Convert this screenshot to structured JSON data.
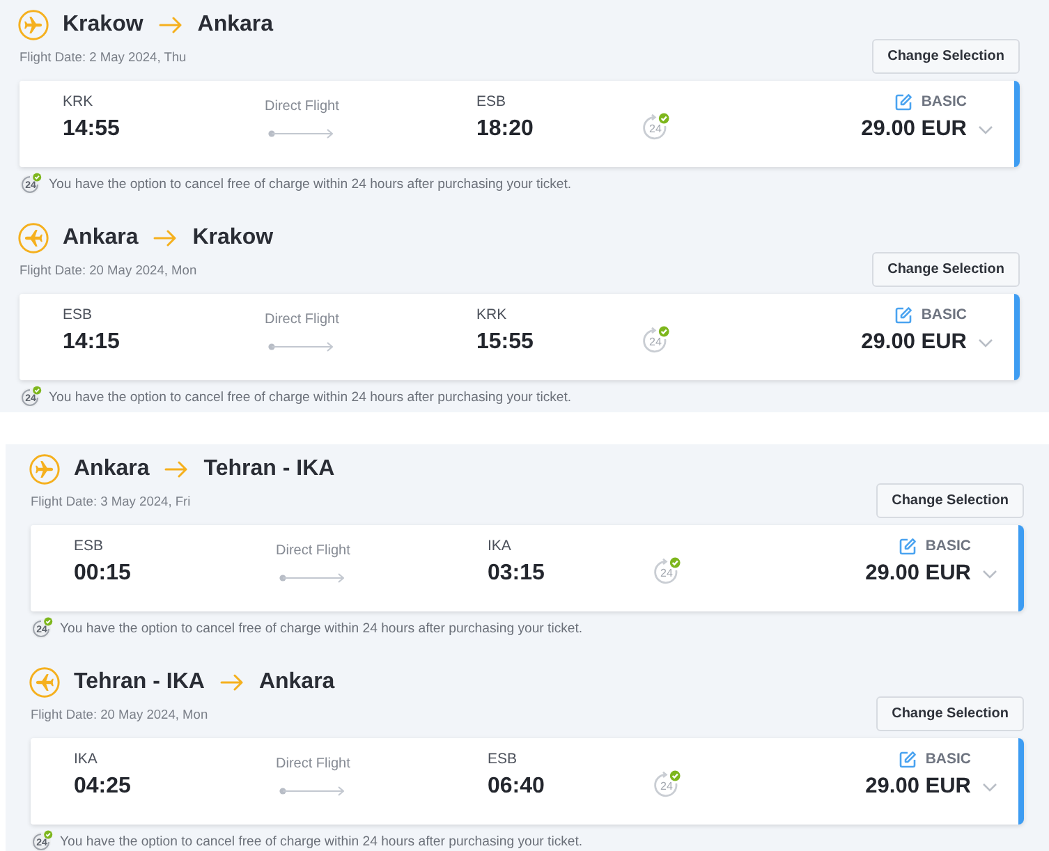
{
  "sections": [
    {
      "flights": [
        {
          "kind": "outbound",
          "origin": "Krakow",
          "destination": "Ankara",
          "flight_date": "Flight Date: 2 May 2024, Thu",
          "change_button": "Change Selection",
          "departure": {
            "code": "KRK",
            "time": "14:55"
          },
          "connection": "Direct Flight",
          "arrival": {
            "code": "ESB",
            "time": "18:20"
          },
          "cancel_badge": "24",
          "fare": "BASIC",
          "price": "29.00 EUR",
          "note": {
            "badge": "24",
            "text": "You have the option to cancel free of charge within 24 hours after purchasing your ticket."
          }
        },
        {
          "kind": "return",
          "origin": "Ankara",
          "destination": "Krakow",
          "flight_date": "Flight Date: 20 May 2024, Mon",
          "change_button": "Change Selection",
          "departure": {
            "code": "ESB",
            "time": "14:15"
          },
          "connection": "Direct Flight",
          "arrival": {
            "code": "KRK",
            "time": "15:55"
          },
          "cancel_badge": "24",
          "fare": "BASIC",
          "price": "29.00 EUR",
          "note": {
            "badge": "24",
            "text": "You have the option to cancel free of charge within 24 hours after purchasing your ticket."
          }
        }
      ]
    },
    {
      "flights": [
        {
          "kind": "outbound",
          "origin": "Ankara",
          "destination": "Tehran - IKA",
          "flight_date": "Flight Date: 3 May 2024, Fri",
          "change_button": "Change Selection",
          "departure": {
            "code": "ESB",
            "time": "00:15"
          },
          "connection": "Direct Flight",
          "arrival": {
            "code": "IKA",
            "time": "03:15"
          },
          "cancel_badge": "24",
          "fare": "BASIC",
          "price": "29.00 EUR",
          "note": {
            "badge": "24",
            "text": "You have the option to cancel free of charge within 24 hours after purchasing your ticket."
          }
        },
        {
          "kind": "return",
          "origin": "Tehran - IKA",
          "destination": "Ankara",
          "flight_date": "Flight Date: 20 May 2024, Mon",
          "change_button": "Change Selection",
          "departure": {
            "code": "IKA",
            "time": "04:25"
          },
          "connection": "Direct Flight",
          "arrival": {
            "code": "ESB",
            "time": "06:40"
          },
          "cancel_badge": "24",
          "fare": "BASIC",
          "price": "29.00 EUR",
          "note": {
            "badge": "24",
            "text": "You have the option to cancel free of charge within 24 hours after purchasing your ticket."
          }
        }
      ]
    }
  ]
}
